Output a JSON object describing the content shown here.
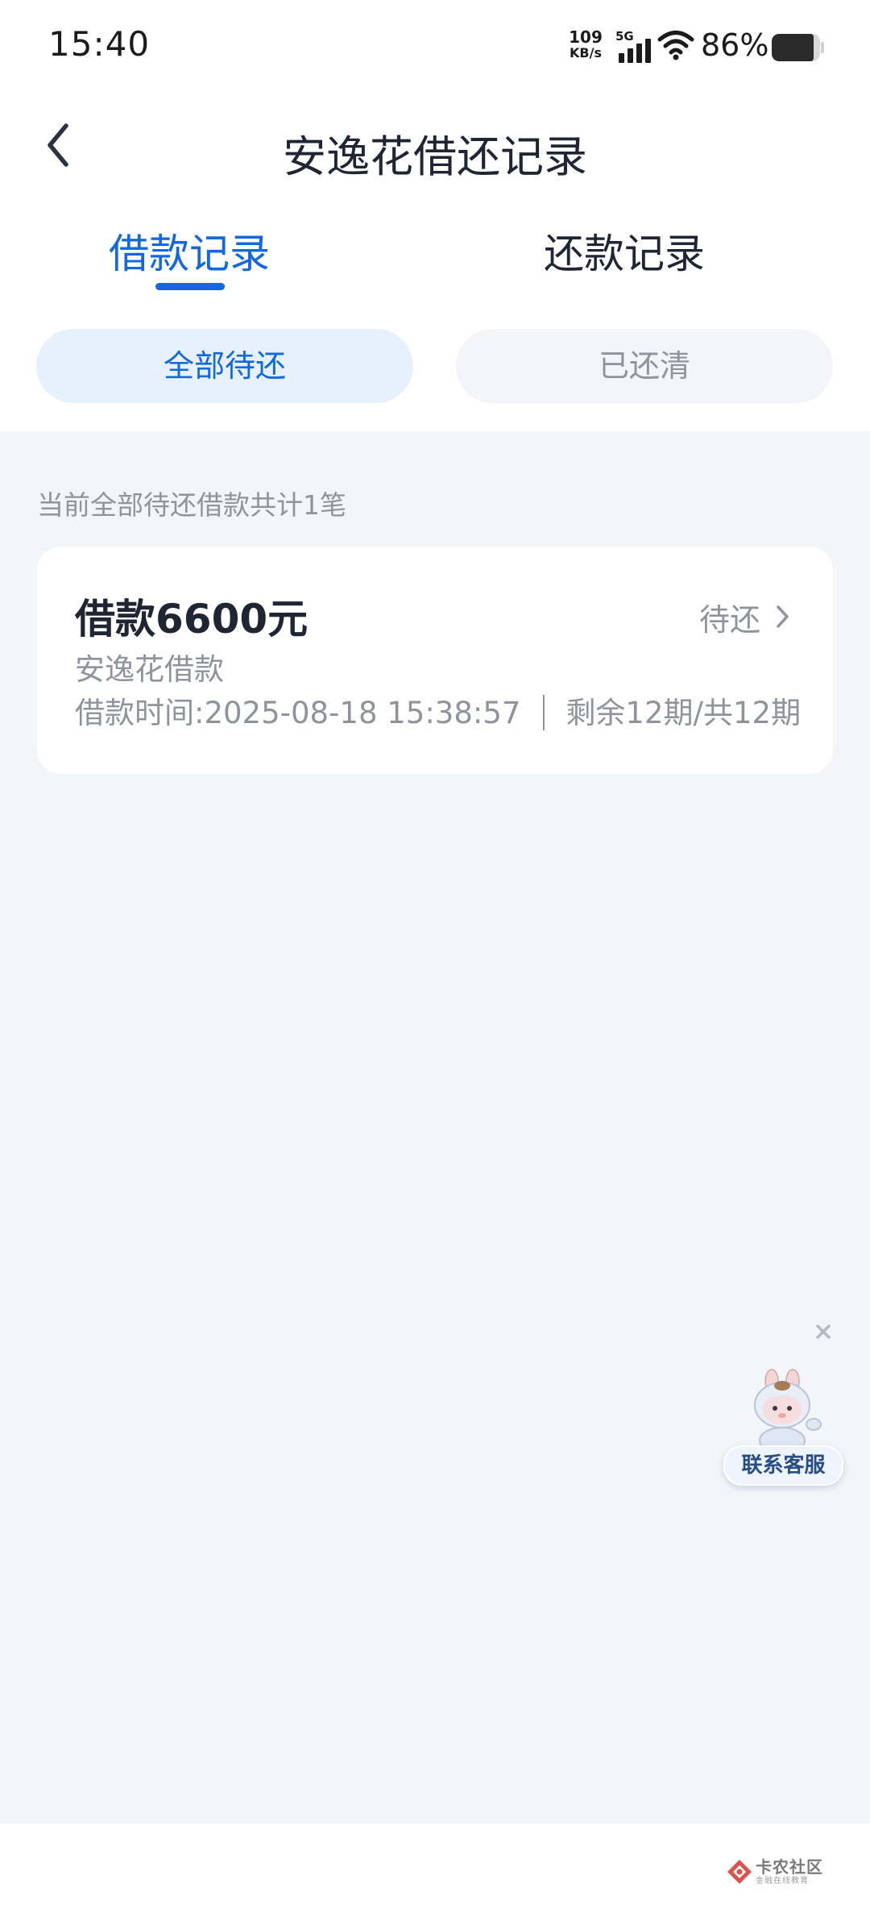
{
  "status_bar": {
    "time": "15:40",
    "net_speed_value": "109",
    "net_speed_unit": "KB/s",
    "network_type": "5G",
    "battery_percent_text": "86%",
    "battery_level": 0.86,
    "icons": [
      "signal-icon",
      "wifi-icon",
      "battery-icon"
    ]
  },
  "header": {
    "title": "安逸花借还记录",
    "back_icon": "chevron-left-icon"
  },
  "tabs": [
    {
      "label": "借款记录",
      "active": true
    },
    {
      "label": "还款记录",
      "active": false
    }
  ],
  "filters": [
    {
      "label": "全部待还",
      "active": true
    },
    {
      "label": "已还清",
      "active": false
    }
  ],
  "summary_text": "当前全部待还借款共计1笔",
  "loans": [
    {
      "amount_text": "借款6600元",
      "status": "待还",
      "product": "安逸花借款",
      "time_text": "借款时间:2025-08-18 15:38:57",
      "periods_text": "剩余12期/共12期"
    }
  ],
  "customer_service": {
    "label": "联系客服",
    "close_icon": "close-icon"
  },
  "watermark": {
    "title": "卡农社区",
    "subtitle": "金融在线教育"
  },
  "colors": {
    "accent": "#1367e0",
    "active_pill_bg": "#e6f1fd",
    "page_bg": "#f3f5f8",
    "muted_text": "#8e939c",
    "primary_text": "#1f2533"
  }
}
